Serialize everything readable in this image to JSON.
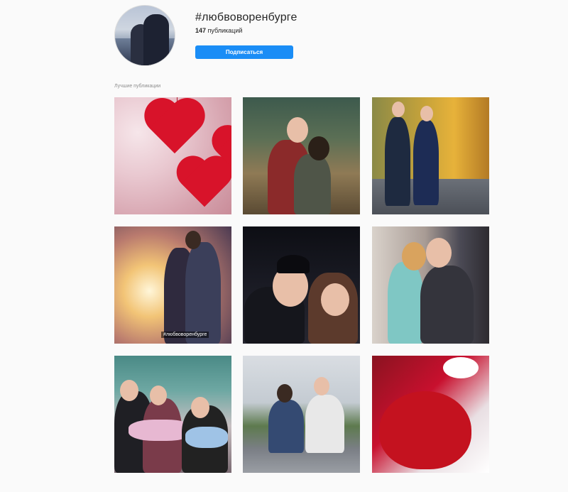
{
  "header": {
    "hashtag": "#любвоворенбурге",
    "post_count": "147",
    "post_count_suffix": " публикаций",
    "follow_label": "Подписаться"
  },
  "section": {
    "label": "Лучшие публикации"
  },
  "posts": [
    {
      "overlay_text": ""
    },
    {
      "overlay_text": ""
    },
    {
      "overlay_text": ""
    },
    {
      "overlay_text": "#любвоворенбурге"
    },
    {
      "overlay_text": ""
    },
    {
      "overlay_text": ""
    },
    {
      "overlay_text": ""
    },
    {
      "overlay_text": ""
    },
    {
      "overlay_text": ""
    }
  ],
  "colors": {
    "accent": "#1a8df6",
    "background": "#fafafa",
    "text": "#262626",
    "muted": "#8e8e8e"
  }
}
